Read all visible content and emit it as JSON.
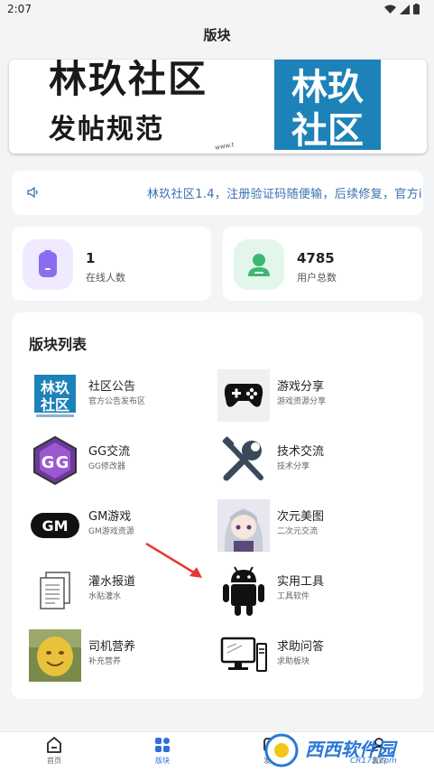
{
  "status_bar": {
    "time": "2:07"
  },
  "app": {
    "title": "版块"
  },
  "banner": {
    "title": "林玖社区",
    "subtitle": "发帖规范",
    "logo_text_top": "林玖",
    "logo_text_bottom": "社区",
    "tiny_text": "www.t"
  },
  "notice": {
    "text": "林玖社区1.4，注册验证码随便输，后续修复，官方i"
  },
  "stats": [
    {
      "value": "1",
      "label": "在线人数",
      "icon": "phone-icon",
      "color": "#8b6cf0",
      "bg": "#efeafd"
    },
    {
      "value": "4785",
      "label": "用户总数",
      "icon": "user-icon",
      "color": "#3cb873",
      "bg": "#e3f6ec"
    }
  ],
  "board": {
    "title": "版块列表",
    "items": [
      {
        "name": "社区公告",
        "desc": "官方公告发布区",
        "icon": "community-logo-icon"
      },
      {
        "name": "游戏分享",
        "desc": "游戏资源分享",
        "icon": "gamepad-icon"
      },
      {
        "name": "GG交流",
        "desc": "GG修改器",
        "icon": "gg-logo-icon"
      },
      {
        "name": "技术交流",
        "desc": "技术分享",
        "icon": "tools-icon"
      },
      {
        "name": "GM游戏",
        "desc": "GM游戏资源",
        "icon": "gm-logo-icon"
      },
      {
        "name": "次元美图",
        "desc": "二次元交流",
        "icon": "anime-girl-icon"
      },
      {
        "name": "灌水报道",
        "desc": "水贴灌水",
        "icon": "document-icon"
      },
      {
        "name": "实用工具",
        "desc": "工具软件",
        "icon": "android-icon"
      },
      {
        "name": "司机营养",
        "desc": "补充营养",
        "icon": "yellow-figure-icon"
      },
      {
        "name": "求助问答",
        "desc": "求助板块",
        "icon": "computer-icon"
      }
    ]
  },
  "bottom_nav": [
    {
      "label": "首页",
      "icon": "home-icon",
      "active": false
    },
    {
      "label": "版块",
      "icon": "grid-icon",
      "active": true
    },
    {
      "label": "发帖",
      "icon": "post-icon",
      "active": false
    },
    {
      "label": "我的",
      "icon": "user-icon",
      "active": false
    }
  ],
  "watermark": {
    "text": "西西软件园",
    "url": "CR173.com"
  },
  "colors": {
    "accent": "#2f6fd6",
    "notice": "#3a6fb0"
  }
}
